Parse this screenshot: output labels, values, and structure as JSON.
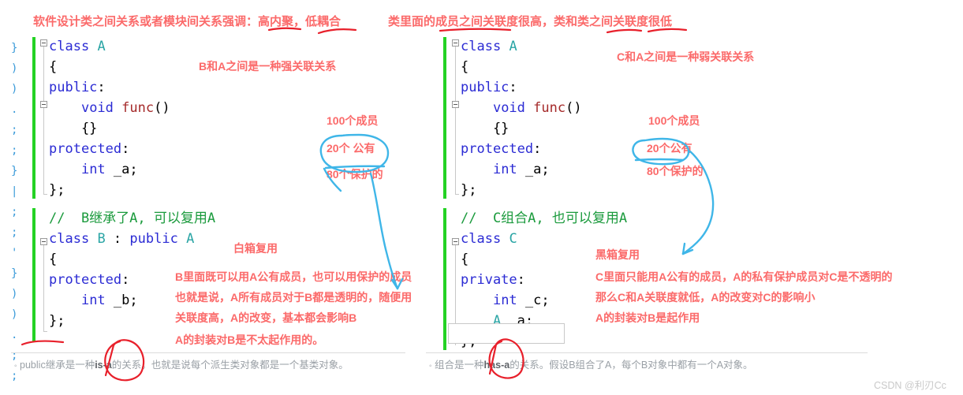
{
  "headers": {
    "left": "软件设计类之间关系或者模块间关系强调：高内聚，低耦合",
    "right": "类里面的成员之间关联度很高，类和类之间关联度很低"
  },
  "left_panel": {
    "class_a": [
      "class A",
      "{",
      "public:",
      "    void func()",
      "    {}",
      "protected:",
      "    int _a;",
      "};"
    ],
    "comment_b": "//  B继承了A, 可以复用A",
    "class_b": [
      "class B : public A",
      "{",
      "protected:",
      "    int _b;",
      "};"
    ],
    "gutter_glyphs": [
      "}",
      ")",
      ")",
      ".",
      ";",
      ";",
      "}",
      "|",
      ";",
      ";",
      "'",
      "}",
      ")",
      ")",
      ".",
      ";",
      ";"
    ]
  },
  "right_panel": {
    "class_a": [
      "class A",
      "{",
      "public:",
      "    void func()",
      "    {}",
      "protected:",
      "    int _a;",
      "};"
    ],
    "comment_c": "//  C组合A, 也可以复用A",
    "class_c": [
      "class C",
      "{",
      "private:",
      "    int _c;",
      "    A _a;",
      "};"
    ]
  },
  "notes": {
    "left_rel": "B和A之间是一种强关联关系",
    "right_rel": "C和A之间是一种弱关联关系",
    "left_members": [
      "100个成员",
      "20个 公有",
      "80个保护的"
    ],
    "right_members": [
      "100个成员",
      "20个公有",
      "80个保护的"
    ],
    "left_reuse_title": "白箱复用",
    "left_reuse_lines": [
      "B里面既可以用A公有成员，也可以用保护的成员",
      "也就是说，A所有成员对于B都是透明的，随便用",
      "关联度高，A的改变，基本都会影响B",
      "A的封装对B是不太起作用的。"
    ],
    "right_reuse_title": "黑箱复用",
    "right_reuse_lines": [
      "C里面只能用A公有的成员，A的私有保护成员对C是不透明的",
      "那么C和A关联度就低，A的改变对C的影响小",
      "A的封装对B是起作用"
    ]
  },
  "footers": {
    "left_pre": "public继承是一种",
    "left_bold": "is-a",
    "left_post": "的关系。也就是说每个派生类对象都是一个基类对象。",
    "right_pre": "组合是一种",
    "right_bold": "has-a",
    "right_post": "的关系。假设B组合了A，每个B对象中都有一个A对象。"
  },
  "watermark": "CSDN @利刃Cc",
  "colors": {
    "annotation_red": "#fb6a6a",
    "ink_red": "#e8202b",
    "ink_blue": "#3fb6e8",
    "keyword_blue": "#2b2bd4",
    "type_teal": "#2aa5a5",
    "function_darkred": "#a52a2a",
    "comment_green": "#1a9a3c",
    "change_bar_green": "#24d224",
    "footer_gray": "#9aa0a6"
  }
}
